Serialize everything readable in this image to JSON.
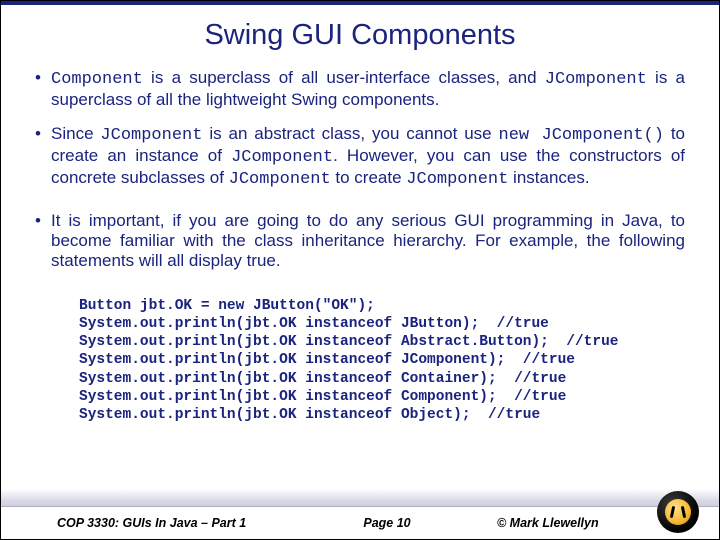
{
  "title": "Swing GUI Components",
  "bullets": [
    {
      "parts": [
        {
          "t": "Component",
          "mono": true
        },
        {
          "t": " is a superclass of all user-interface classes, and "
        },
        {
          "t": "JComponent",
          "mono": true
        },
        {
          "t": " is a superclass of all the lightweight Swing components."
        }
      ]
    },
    {
      "parts": [
        {
          "t": "Since "
        },
        {
          "t": "JComponent",
          "mono": true
        },
        {
          "t": " is an abstract class, you cannot use "
        },
        {
          "t": "new JComponent()",
          "mono": true
        },
        {
          "t": " to create an instance of "
        },
        {
          "t": "JComponent",
          "mono": true
        },
        {
          "t": ". However, you can use the constructors of concrete subclasses of "
        },
        {
          "t": "JComponent",
          "mono": true
        },
        {
          "t": " to create "
        },
        {
          "t": "JComponent",
          "mono": true
        },
        {
          "t": " instances."
        }
      ]
    },
    {
      "parts": [
        {
          "t": "It is important, if you are going to do any serious GUI programming in Java, to become familiar with the class inheritance hierarchy.  For example, the following statements will all display true."
        }
      ]
    }
  ],
  "code": "Button jbt.OK = new JButton(\"OK\");\nSystem.out.println(jbt.OK instanceof JButton);  //true\nSystem.out.println(jbt.OK instanceof Abstract.Button);  //true\nSystem.out.println(jbt.OK instanceof JComponent);  //true\nSystem.out.println(jbt.OK instanceof Container);  //true\nSystem.out.println(jbt.OK instanceof Component);  //true\nSystem.out.println(jbt.OK instanceof Object);  //true",
  "footer": {
    "course": "COP 3330:  GUIs In Java – Part 1",
    "page": "Page 10",
    "copyright": "© Mark Llewellyn"
  }
}
